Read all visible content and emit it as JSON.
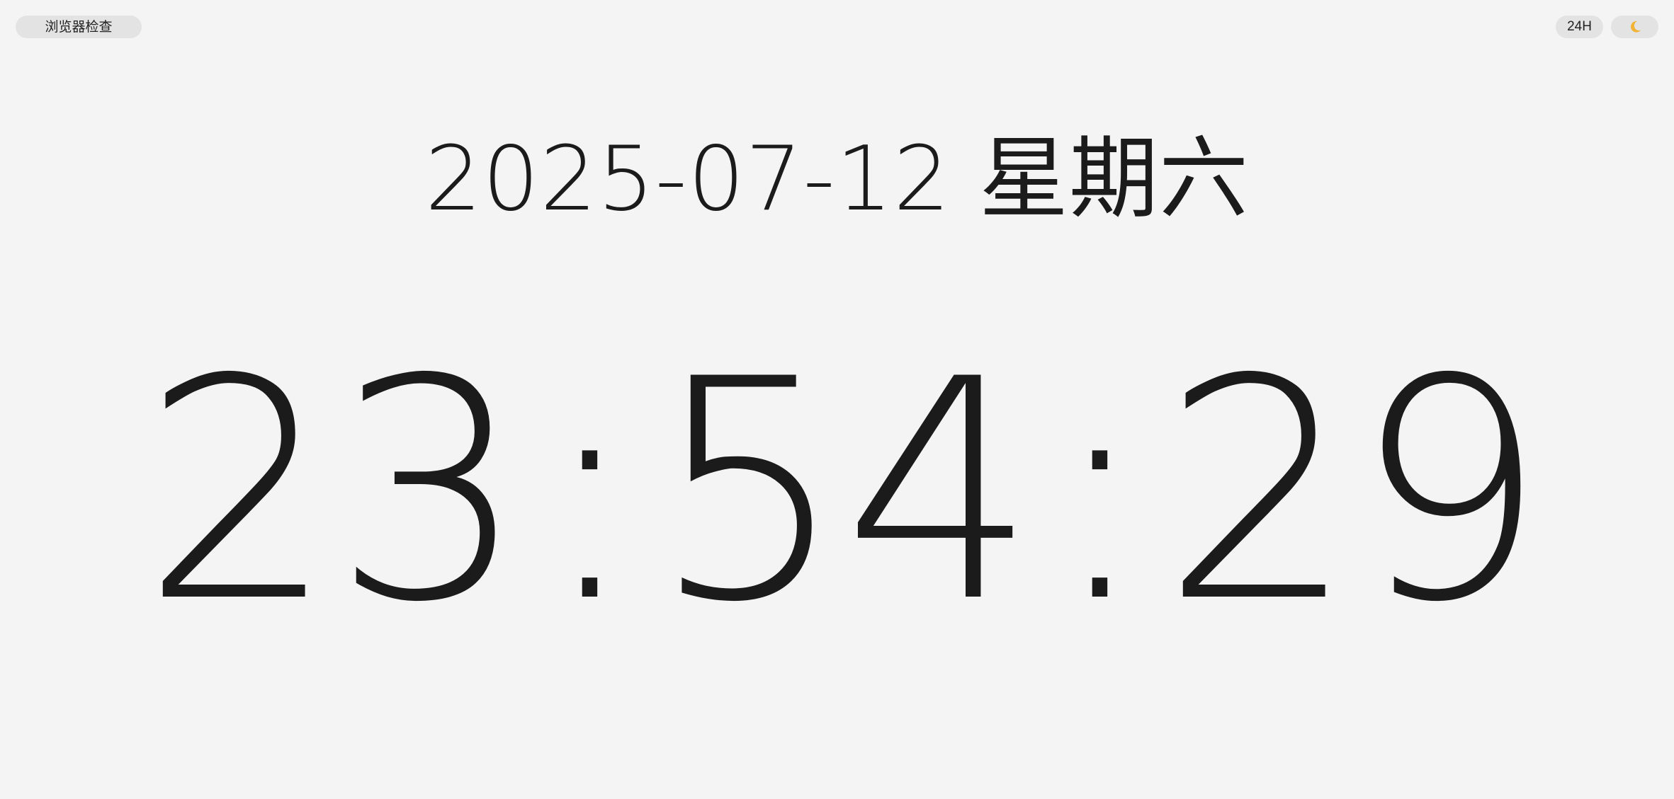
{
  "toolbar": {
    "browser_check_label": "浏览器检查",
    "hour_format_label": "24H",
    "theme_toggle_icon": "moon-icon"
  },
  "date": {
    "ymd": "2025-07-12",
    "weekday": "星期六"
  },
  "time": {
    "hh": [
      "2",
      "3"
    ],
    "mm": [
      "5",
      "4"
    ],
    "ss": [
      "2",
      "9"
    ],
    "separator": ":"
  },
  "colors": {
    "background": "#f4f4f4",
    "text": "#1b1b1b",
    "pill": "#e3e3e3",
    "moon": "#f2b233"
  }
}
